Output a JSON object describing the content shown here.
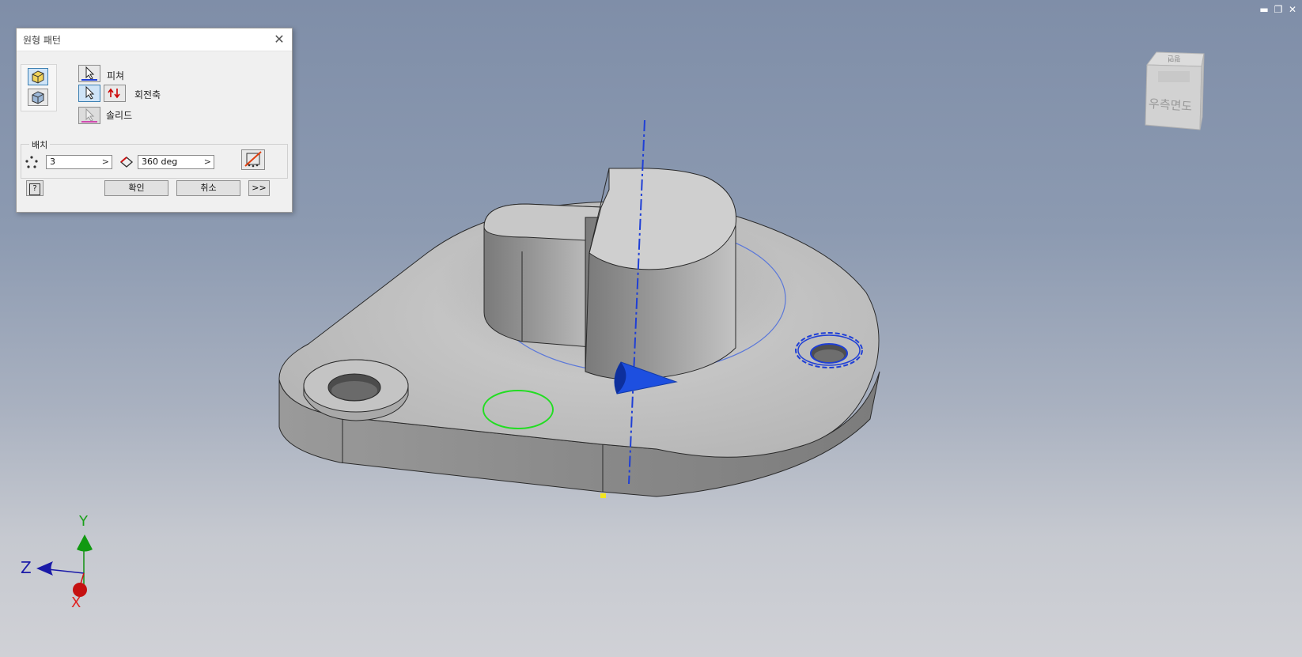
{
  "window_controls": {
    "minimize": "▬",
    "restore": "❐",
    "close": "✕"
  },
  "dialog": {
    "title": "원형 패턴",
    "close_glyph": "✕",
    "feature_label": "피쳐",
    "axis_label": "회전축",
    "solid_label": "솔리드",
    "layout_legend": "배치",
    "count_value": "3",
    "angle_value": "360 deg",
    "field_arrow": ">",
    "ok_label": "확인",
    "cancel_label": "취소",
    "more_label": ">>",
    "help_glyph": "?"
  },
  "viewcube": {
    "face_label": "우측면도",
    "top_label": "평면"
  },
  "triad": {
    "x_label": "X",
    "y_label": "Y",
    "z_label": "Z"
  },
  "colors": {
    "axis_blue": "#1f3fd6",
    "selection_green": "#22dd22",
    "part_gray": "#b6b6b6",
    "triad_x": "#d01010",
    "triad_y": "#109010",
    "triad_z": "#1a1aa8"
  }
}
